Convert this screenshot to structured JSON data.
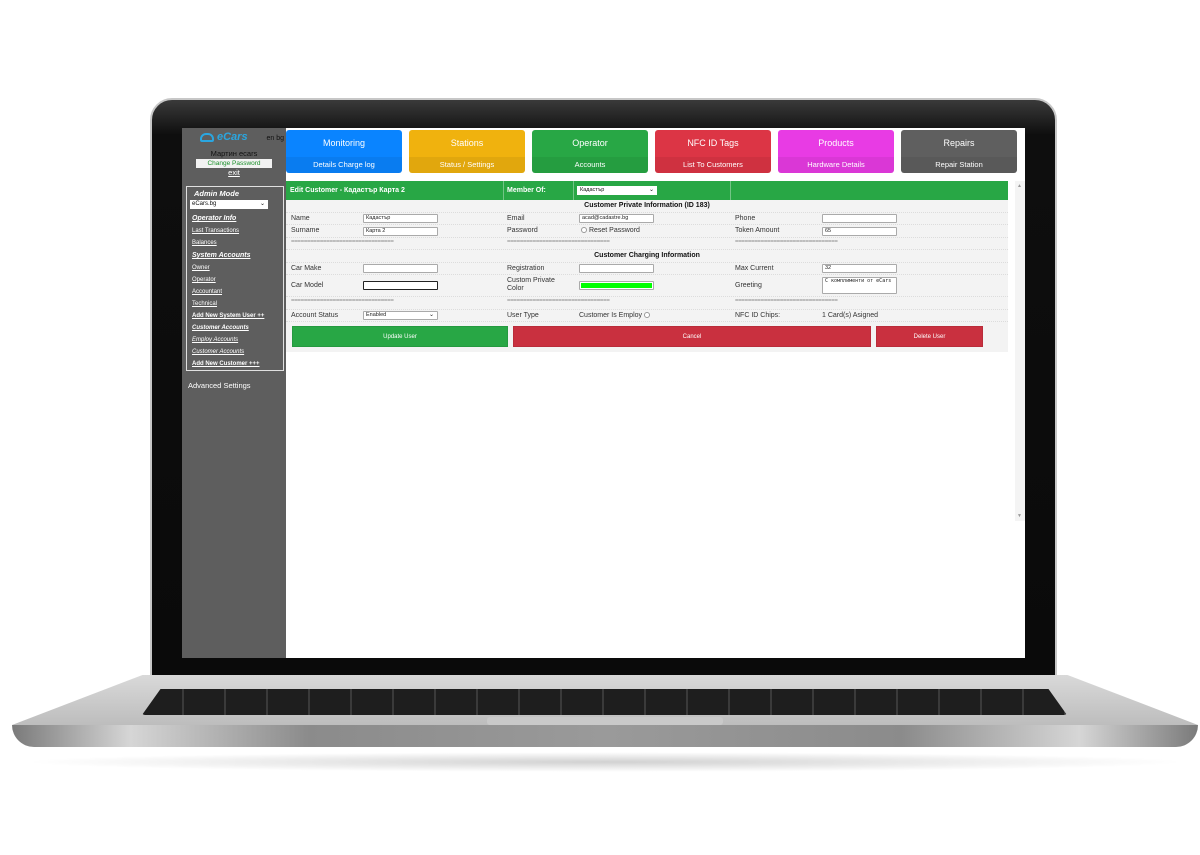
{
  "sidebar": {
    "logo_text": "eCars",
    "language": "en bg",
    "user_name": "Мартин ecars",
    "change_password": "Change Password",
    "exit": "exit",
    "admin_title": "Admin Mode",
    "admin_select_value": "eCars.bg",
    "links": [
      {
        "label": "Operator Info",
        "style": "section"
      },
      {
        "label": "Last Transactions",
        "style": "normal"
      },
      {
        "label": "Balances",
        "style": "normal"
      },
      {
        "label": "System Accounts",
        "style": "section"
      },
      {
        "label": "Owner",
        "style": "normal"
      },
      {
        "label": "Operator",
        "style": "normal"
      },
      {
        "label": "Accountant",
        "style": "normal"
      },
      {
        "label": "Technical",
        "style": "normal"
      },
      {
        "label": "Add New System User ++",
        "style": "bold"
      },
      {
        "label": "Customer Accounts",
        "style": "section-small"
      },
      {
        "label": "Employ Accounts",
        "style": "italic"
      },
      {
        "label": "Customer Accounts",
        "style": "italic"
      },
      {
        "label": "Add New Customer +++",
        "style": "bold"
      }
    ],
    "advanced_settings": "Advanced Settings"
  },
  "nav_tiles": [
    {
      "title": "Monitoring",
      "subtitle": "Details Charge log",
      "color": "#0a84ff"
    },
    {
      "title": "Stations",
      "subtitle": "Status / Settings",
      "color": "#f0b20e"
    },
    {
      "title": "Operator",
      "subtitle": "Accounts",
      "color": "#28a745"
    },
    {
      "title": "NFC ID Tags",
      "subtitle": "List To Customers",
      "color": "#dc3545"
    },
    {
      "title": "Products",
      "subtitle": "Hardware Details",
      "color": "#e83be4"
    },
    {
      "title": "Repairs",
      "subtitle": "Repair Station",
      "color": "#5f5f5f"
    }
  ],
  "form": {
    "header_title": "Edit Customer - Кадастър Карта 2",
    "member_of_label": "Member Of:",
    "member_of_value": "Кадастър",
    "private_section": "Customer Private Information (ID 183)",
    "charging_section": "Customer Charging Information",
    "separator": "================================",
    "fields": {
      "name": {
        "label": "Name",
        "value": "Кадастър"
      },
      "surname": {
        "label": "Surname",
        "value": "Карта 2"
      },
      "email": {
        "label": "Email",
        "value": "acad@cadastre.bg"
      },
      "password": {
        "label": "Password",
        "option": "Reset Password"
      },
      "phone": {
        "label": "Phone",
        "value": ""
      },
      "token_amount": {
        "label": "Token Amount",
        "value": "65"
      },
      "car_make": {
        "label": "Car Make",
        "value": ""
      },
      "car_model": {
        "label": "Car Model",
        "value": ""
      },
      "registration": {
        "label": "Registration",
        "value": ""
      },
      "custom_color": {
        "label": "Custom Private Color",
        "value": "#00ff00"
      },
      "max_current": {
        "label": "Max Current",
        "value": "32"
      },
      "greeting": {
        "label": "Greeting",
        "value": "С комплименти от eCars"
      },
      "account_status": {
        "label": "Account Status",
        "value": "Enabled"
      },
      "user_type": {
        "label": "User Type",
        "option": "Customer Is Employ"
      },
      "nfc_chips": {
        "label": "NFC ID Chips:",
        "value": "1 Card(s) Asigned"
      }
    },
    "buttons": {
      "update": "Update User",
      "cancel": "Cancel",
      "delete": "Delete User"
    }
  },
  "colors": {
    "header_green": "#28a745",
    "cancel_red": "#c9303f",
    "sidebar_bg": "#5e5e5e"
  }
}
